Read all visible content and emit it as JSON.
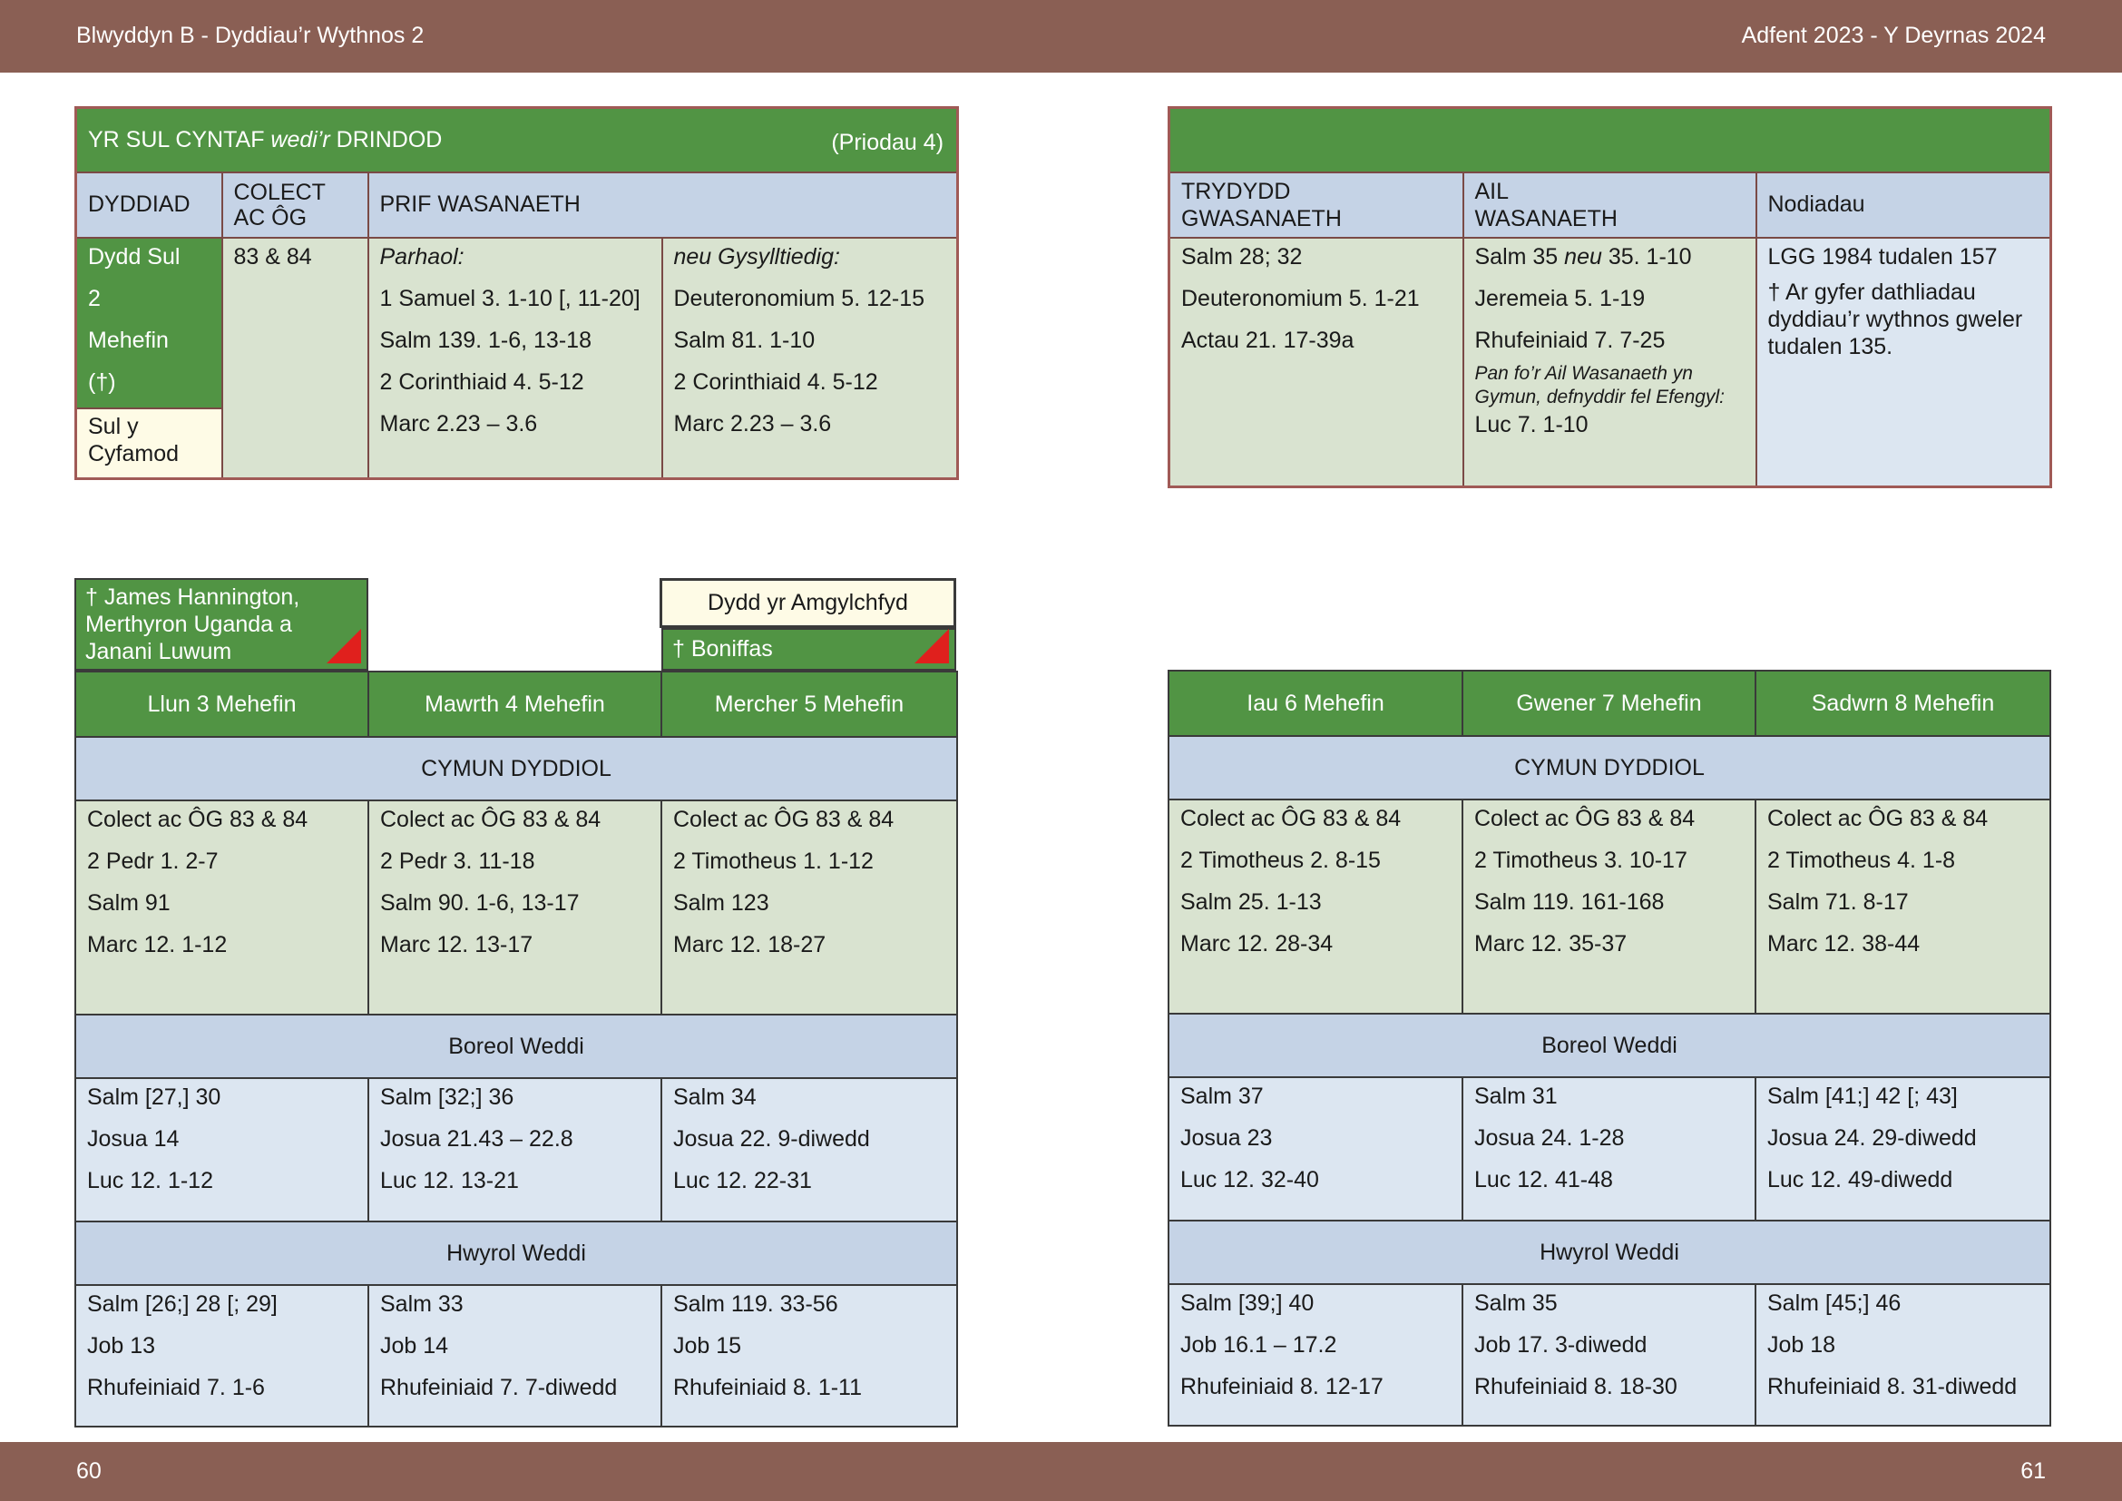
{
  "header": {
    "left": "Blwyddyn  B - Dyddiau’r Wythnos 2",
    "right": "Adfent  2023 - Y Deyrnas 2024"
  },
  "footer": {
    "left": "60",
    "right": "61"
  },
  "colors": {
    "band": "#8a5f54",
    "green": "#519444",
    "light_green": "#d9e3d0",
    "blue": "#c5d3e6",
    "light_blue": "#dce6f1",
    "cream": "#fefbe6",
    "marker_red": "#e0201d"
  },
  "sunday": {
    "title_pre": "YR SUL CYNTAF ",
    "title_it": "wedi’r",
    "title_post": " DRINDOD",
    "title_right": "(Priodau 4)",
    "headers": {
      "date": "DYDDIAD",
      "collect_1": "COLECT",
      "collect_2": "AC ÔG",
      "main": "PRIF WASANAETH"
    },
    "date_lines": [
      "Dydd Sul",
      "2",
      "Mehefin",
      "(†)"
    ],
    "covenant_1": "Sul y",
    "covenant_2": "Cyfamod",
    "collect": "83 & 84",
    "continuous_label": "Parhaol:",
    "continuous": [
      "1 Samuel 3. 1-10 [, 11-20]",
      "Salm 139. 1-6, 13-18",
      "2 Corinthiaid 4. 5-12",
      "Marc 2.23 – 3.6"
    ],
    "related_label": "neu Gysylltiedig:",
    "related": [
      "Deuteronomium 5. 12-15",
      "Salm 81. 1-10",
      "2 Corinthiaid 4. 5-12",
      "Marc 2.23 – 3.6"
    ]
  },
  "sunday_right": {
    "headers": {
      "third_1": "TRYDYDD",
      "third_2": "GWASANAETH",
      "second_1": "AIL",
      "second_2": "WASANAETH",
      "notes": "Nodiadau"
    },
    "third": [
      "Salm 28; 32",
      "Deuteronomium 5. 1-21",
      "Actau 21. 17-39a"
    ],
    "second_first_a": "Salm 35 ",
    "second_first_it": "neu",
    "second_first_b": " 35. 1-10",
    "second": [
      "Jeremeia 5. 1-19",
      "Rhufeiniaid 7. 7-25"
    ],
    "second_note": "Pan fo’r Ail Wasanaeth yn Gymun, defnyddir fel Efengyl:",
    "second_gospel": "Luc 7. 1-10",
    "notes_1": "LGG 1984 tudalen 157",
    "notes_2": "† Ar gyfer dathliadau dyddiau’r wythnos gweler tudalen 135."
  },
  "commemorations": {
    "monday": "† James Hannington, Merthyron Uganda a Janani Luwum",
    "wednesday_title": "Dydd yr Amgylchfyd",
    "wednesday": "† Boniffas"
  },
  "sections": {
    "eucharist": "CYMUN DYDDIOL",
    "morning": "Boreol Weddi",
    "evening": "Hwyrol Weddi"
  },
  "week_left": [
    {
      "day": "Llun 3 Mehefin",
      "eucharist": [
        "Colect ac ÔG 83 & 84",
        "2 Pedr 1. 2-7",
        "Salm 91",
        "Marc 12. 1-12"
      ],
      "morning": [
        "Salm [27,] 30",
        "Josua 14",
        "Luc 12. 1-12"
      ],
      "evening": [
        "Salm [26;] 28 [; 29]",
        "Job 13",
        "Rhufeiniaid 7. 1-6"
      ]
    },
    {
      "day": "Mawrth 4 Mehefin",
      "eucharist": [
        "Colect ac ÔG 83 & 84",
        "2 Pedr 3. 11-18",
        "Salm 90. 1-6, 13-17",
        "Marc 12. 13-17"
      ],
      "morning": [
        "Salm [32;] 36",
        "Josua 21.43 – 22.8",
        "Luc 12. 13-21"
      ],
      "evening": [
        "Salm 33",
        "Job 14",
        "Rhufeiniaid 7. 7-diwedd"
      ]
    },
    {
      "day": "Mercher 5 Mehefin",
      "eucharist": [
        "Colect ac ÔG 83 & 84",
        "2 Timotheus 1. 1-12",
        "Salm 123",
        "Marc 12. 18-27"
      ],
      "morning": [
        "Salm 34",
        "Josua 22. 9-diwedd",
        "Luc 12. 22-31"
      ],
      "evening": [
        "Salm 119. 33-56",
        "Job 15",
        "Rhufeiniaid 8. 1-11"
      ]
    }
  ],
  "week_right": [
    {
      "day": "Iau 6 Mehefin",
      "eucharist": [
        "Colect ac ÔG 83 & 84",
        "2 Timotheus 2. 8-15",
        "Salm 25. 1-13",
        "Marc 12. 28-34"
      ],
      "morning": [
        "Salm 37",
        "Josua 23",
        "Luc 12. 32-40"
      ],
      "evening": [
        "Salm [39;] 40",
        "Job 16.1 – 17.2",
        "Rhufeiniaid 8. 12-17"
      ]
    },
    {
      "day": "Gwener 7 Mehefin",
      "eucharist": [
        "Colect ac ÔG 83 & 84",
        "2 Timotheus 3. 10-17",
        "Salm 119. 161-168",
        "Marc 12. 35-37"
      ],
      "morning": [
        "Salm 31",
        "Josua 24. 1-28",
        "Luc 12. 41-48"
      ],
      "evening": [
        "Salm 35",
        "Job 17. 3-diwedd",
        "Rhufeiniaid 8. 18-30"
      ]
    },
    {
      "day": "Sadwrn 8 Mehefin",
      "eucharist": [
        "Colect ac ÔG 83 & 84",
        "2 Timotheus 4. 1-8",
        "Salm 71. 8-17",
        "Marc 12. 38-44"
      ],
      "morning": [
        "Salm [41;] 42 [; 43]",
        "Josua 24. 29-diwedd",
        "Luc 12. 49-diwedd"
      ],
      "evening": [
        "Salm [45;] 46",
        "Job 18",
        "Rhufeiniaid 8. 31-diwedd"
      ]
    }
  ]
}
